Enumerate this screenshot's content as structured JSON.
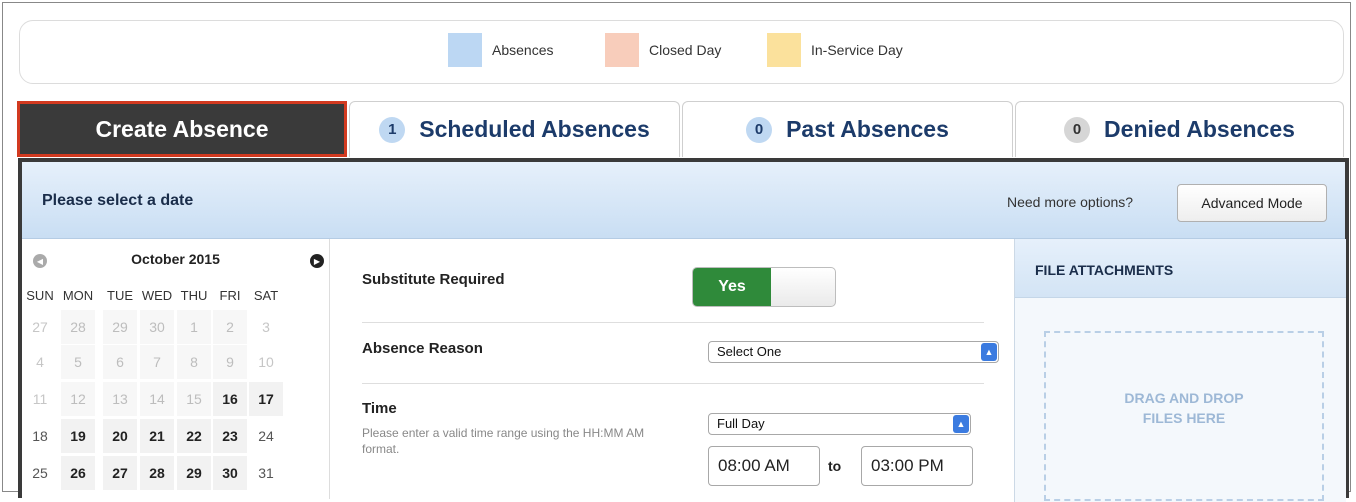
{
  "legend": {
    "items": [
      {
        "label": "Absences",
        "color": "#bcd7f3"
      },
      {
        "label": "Closed Day",
        "color": "#f8cdbb"
      },
      {
        "label": "In-Service Day",
        "color": "#fbe19c"
      }
    ]
  },
  "tabs": [
    {
      "label": "Create Absence",
      "active": true
    },
    {
      "label": "Scheduled Absences",
      "count": "1"
    },
    {
      "label": "Past Absences",
      "count": "0"
    },
    {
      "label": "Denied Absences",
      "count": "0"
    }
  ],
  "header": {
    "prompt": "Please select a date",
    "options_text": "Need more options?",
    "advanced_button": "Advanced Mode"
  },
  "calendar": {
    "month": "October 2015",
    "days_of_week": [
      "SUN",
      "MON",
      "TUE",
      "WED",
      "THU",
      "FRI",
      "SAT"
    ],
    "weeks": [
      [
        "27",
        "28",
        "29",
        "30",
        "1",
        "2",
        "3"
      ],
      [
        "4",
        "5",
        "6",
        "7",
        "8",
        "9",
        "10"
      ],
      [
        "11",
        "12",
        "13",
        "14",
        "15",
        "16",
        "17"
      ],
      [
        "18",
        "19",
        "20",
        "21",
        "22",
        "23",
        "24"
      ],
      [
        "25",
        "26",
        "27",
        "28",
        "29",
        "30",
        "31"
      ]
    ]
  },
  "form": {
    "substitute": {
      "label": "Substitute Required",
      "value": "Yes"
    },
    "reason": {
      "label": "Absence Reason",
      "value": "Select One"
    },
    "time": {
      "label": "Time",
      "help": "Please enter a valid time range using the HH:MM AM format.",
      "duration": "Full Day",
      "start": "08:00 AM",
      "to_label": "to",
      "end": "03:00 PM"
    }
  },
  "attachments": {
    "title": "FILE ATTACHMENTS",
    "drop_line1": "DRAG AND DROP",
    "drop_line2": "FILES HERE"
  }
}
